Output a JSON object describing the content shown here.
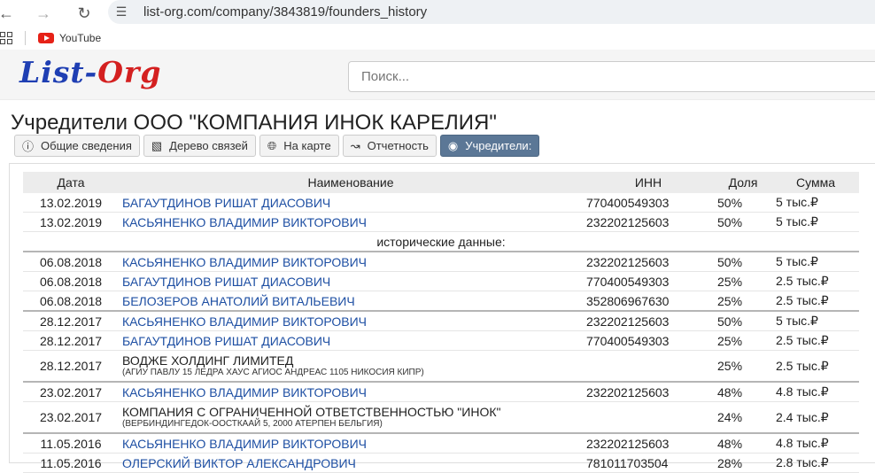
{
  "browser": {
    "url": "list-org.com/company/3843819/founders_history",
    "bookmark": "YouTube"
  },
  "site": {
    "logo_part1": "List-",
    "logo_part2": "Org",
    "search_placeholder": "Поиск..."
  },
  "page": {
    "title": "Учредители ООО \"КОМПАНИЯ ИНОК КАРЕЛИЯ\""
  },
  "tabs": [
    {
      "label": "Общие сведения",
      "icon": "info-icon"
    },
    {
      "label": "Дерево связей",
      "icon": "tree-icon"
    },
    {
      "label": "На карте",
      "icon": "globe-icon"
    },
    {
      "label": "Отчетность",
      "icon": "chart-icon"
    },
    {
      "label": "Учредители:",
      "icon": "eye-icon"
    }
  ],
  "table": {
    "headers": {
      "date": "Дата",
      "name": "Наименование",
      "inn": "ИНН",
      "share": "Доля",
      "sum": "Сумма"
    },
    "historical_label": "исторические данные:",
    "rows": [
      {
        "date": "13.02.2019",
        "name": "БАГАУТДИНОВ РИШАТ ДИАСОВИЧ",
        "inn": "770400549303",
        "share": "50%",
        "sum": "5 тыс.₽"
      },
      {
        "date": "13.02.2019",
        "name": "КАСЬЯНЕНКО ВЛАДИМИР ВИКТОРОВИЧ",
        "inn": "232202125603",
        "share": "50%",
        "sum": "5 тыс.₽"
      },
      {
        "date": "06.08.2018",
        "name": "КАСЬЯНЕНКО ВЛАДИМИР ВИКТОРОВИЧ",
        "inn": "232202125603",
        "share": "50%",
        "sum": "5 тыс.₽"
      },
      {
        "date": "06.08.2018",
        "name": "БАГАУТДИНОВ РИШАТ ДИАСОВИЧ",
        "inn": "770400549303",
        "share": "25%",
        "sum": "2.5 тыс.₽"
      },
      {
        "date": "06.08.2018",
        "name": "БЕЛОЗЕРОВ АНАТОЛИЙ ВИТАЛЬЕВИЧ",
        "inn": "352806967630",
        "share": "25%",
        "sum": "2.5 тыс.₽"
      },
      {
        "date": "28.12.2017",
        "name": "КАСЬЯНЕНКО ВЛАДИМИР ВИКТОРОВИЧ",
        "inn": "232202125603",
        "share": "50%",
        "sum": "5 тыс.₽"
      },
      {
        "date": "28.12.2017",
        "name": "БАГАУТДИНОВ РИШАТ ДИАСОВИЧ",
        "inn": "770400549303",
        "share": "25%",
        "sum": "2.5 тыс.₽"
      },
      {
        "date": "28.12.2017",
        "name": "ВОДЖЕ ХОЛДИНГ ЛИМИТЕД",
        "address": "(АГИУ ПАВЛУ 15 ЛЕДРА ХАУС АГИОС АНДРЕАС 1105 НИКОСИЯ КИПР)",
        "inn": "",
        "share": "25%",
        "sum": "2.5 тыс.₽"
      },
      {
        "date": "23.02.2017",
        "name": "КАСЬЯНЕНКО ВЛАДИМИР ВИКТОРОВИЧ",
        "inn": "232202125603",
        "share": "48%",
        "sum": "4.8 тыс.₽"
      },
      {
        "date": "23.02.2017",
        "name": "КОМПАНИЯ С ОГРАНИЧЕННОЙ ОТВЕТСТВЕННОСТЬЮ \"ИНОК\"",
        "address": "(ВЕРБИНДИНГЕДОК-ООСТКААЙ 5, 2000 АТЕРПЕН БЕЛЬГИЯ)",
        "inn": "",
        "share": "24%",
        "sum": "2.4 тыс.₽"
      },
      {
        "date": "11.05.2016",
        "name": "КАСЬЯНЕНКО ВЛАДИМИР ВИКТОРОВИЧ",
        "inn": "232202125603",
        "share": "48%",
        "sum": "4.8 тыс.₽"
      },
      {
        "date": "11.05.2016",
        "name": "ОЛЕРСКИЙ ВИКТОР АЛЕКСАНДРОВИЧ",
        "inn": "781011703504",
        "share": "28%",
        "sum": "2.8 тыс.₽"
      }
    ]
  }
}
